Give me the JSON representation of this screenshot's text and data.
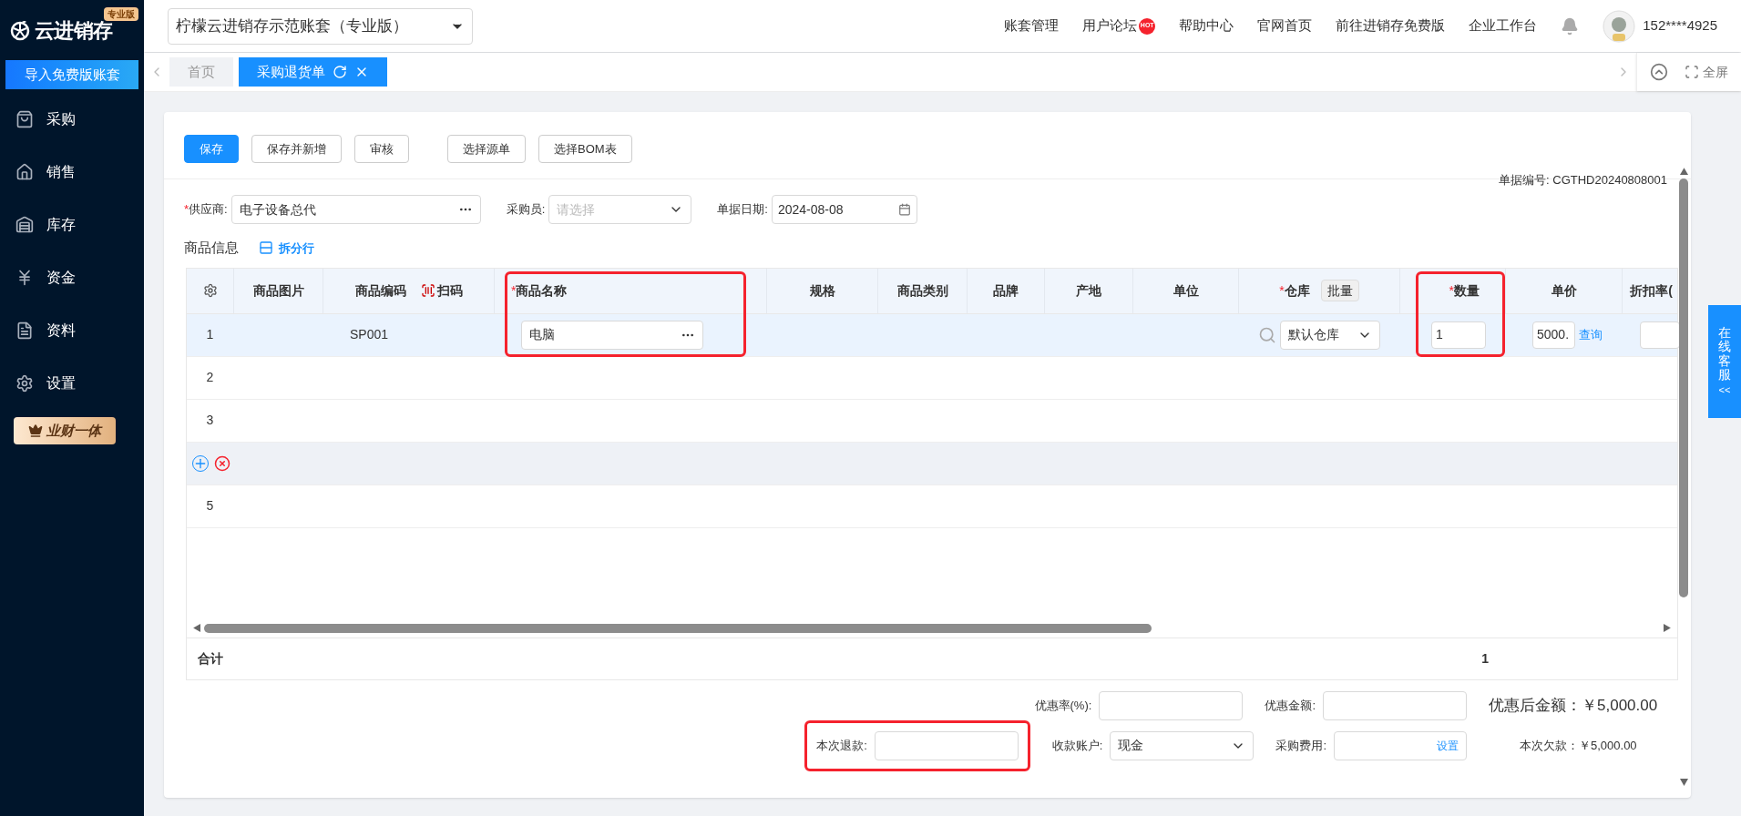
{
  "sidebar": {
    "logo": {
      "text": "云进销存",
      "badge": "专业版"
    },
    "import_button": "导入免费版账套",
    "items": [
      {
        "kind": "bag",
        "label": "采购"
      },
      {
        "kind": "sale",
        "label": "销售"
      },
      {
        "kind": "stock",
        "label": "库存"
      },
      {
        "kind": "yen",
        "label": "资金"
      },
      {
        "kind": "doc",
        "label": "资料"
      },
      {
        "kind": "gear",
        "label": "设置"
      }
    ],
    "promo": "业财一体"
  },
  "header": {
    "account_select": "柠檬云进销存示范账套（专业版）",
    "links": [
      {
        "label": "账套管理",
        "hot": false
      },
      {
        "label": "用户论坛",
        "hot": true,
        "hot_text": "HOT"
      },
      {
        "label": "帮助中心",
        "hot": false
      },
      {
        "label": "官网首页",
        "hot": false
      },
      {
        "label": "前往进销存免费版",
        "hot": false
      },
      {
        "label": "企业工作台",
        "hot": false
      }
    ],
    "user": "152****4925"
  },
  "tabs": [
    {
      "label": "首页",
      "selected": false
    },
    {
      "label": "采购退货单",
      "selected": true
    }
  ],
  "fullscreen": "全屏",
  "toolbar": [
    {
      "label": "保存",
      "primary": true
    },
    {
      "label": "保存并新增",
      "primary": false
    },
    {
      "label": "审核",
      "primary": false
    },
    {
      "label": "选择源单",
      "primary": false
    },
    {
      "label": "选择BOM表",
      "primary": false
    }
  ],
  "doc_number": "单据编号: CGTHD20240808001",
  "form": {
    "supplier": {
      "mark": "*",
      "label": "供应商:",
      "value": "电子设备总代"
    },
    "buyer": {
      "label": "采购员:",
      "placeholder": "请选择"
    },
    "date": {
      "label": "单据日期:",
      "value": "2024-08-08"
    }
  },
  "section_title": "商品信息",
  "split_link": "拆分行",
  "table": {
    "columns": [
      {
        "label": "商品图片",
        "highlighted": false
      },
      {
        "label": "商品编码",
        "highlighted": false,
        "scan": "扫码"
      },
      {
        "mark": "*",
        "label": "商品名称",
        "highlighted": true
      },
      {
        "label": "规格",
        "highlighted": false
      },
      {
        "label": "商品类别",
        "highlighted": false
      },
      {
        "label": "品牌",
        "highlighted": false
      },
      {
        "label": "产地",
        "highlighted": false
      },
      {
        "label": "单位",
        "highlighted": false
      },
      {
        "mark": "*",
        "label": "仓库",
        "highlighted": false,
        "batch": "批量"
      },
      {
        "mark": "*",
        "label": "数量",
        "highlighted": true
      },
      {
        "label": "单价",
        "highlighted": false
      },
      {
        "label": "折扣率(",
        "highlighted": false
      }
    ],
    "rows": [
      {
        "kind": "item",
        "selected": true,
        "index": "1",
        "code": "SP001",
        "name": "电脑",
        "warehouse": "默认仓库",
        "quantity": "1",
        "price": "5000.",
        "price_link": "查询"
      },
      {
        "kind": "item",
        "selected": false,
        "index": "2"
      },
      {
        "kind": "item",
        "selected": false,
        "index": "3"
      },
      {
        "kind": "actions"
      },
      {
        "kind": "item",
        "selected": false,
        "index": "5"
      }
    ],
    "total": {
      "label": "合计",
      "quantity": "1"
    }
  },
  "footer": [
    [
      {
        "kind": "input",
        "label": "优惠率(%):",
        "highlighted": false
      },
      {
        "kind": "input",
        "label": "优惠金额:",
        "highlighted": false
      },
      {
        "kind": "amount",
        "label": "优惠后金额：",
        "value": "￥5,000.00",
        "large": true
      }
    ],
    [
      {
        "kind": "input",
        "label": "本次退款:",
        "highlighted": true
      },
      {
        "kind": "select",
        "label": "收款账户:",
        "value": "现金",
        "highlighted": false
      },
      {
        "kind": "link_input",
        "label": "采购费用:",
        "link": "设置",
        "highlighted": false
      },
      {
        "kind": "amount",
        "label": "本次欠款：",
        "value": "￥5,000.00",
        "large": false
      }
    ]
  ],
  "service": {
    "label": "在线客服",
    "arrow": "<<"
  }
}
